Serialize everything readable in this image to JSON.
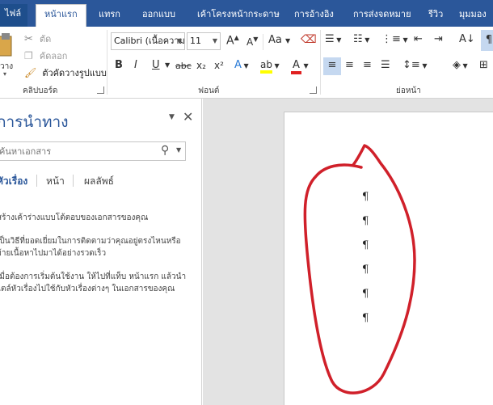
{
  "tabs": [
    {
      "label": "ไฟล์"
    },
    {
      "label": "หน้าแรก"
    },
    {
      "label": "แทรก"
    },
    {
      "label": "ออกแบบ"
    },
    {
      "label": "เค้าโครงหน้ากระดาษ"
    },
    {
      "label": "การอ้างอิง"
    },
    {
      "label": "การส่งจดหมาย"
    },
    {
      "label": "รีวิว"
    },
    {
      "label": "มุมมอง"
    }
  ],
  "clipboard": {
    "paste_label": "วาง",
    "cut_label": "ตัด",
    "copy_label": "คัดลอก",
    "format_painter_label": "ตัวคัดวางรูปแบบ",
    "group_label": "คลิปบอร์ด"
  },
  "font": {
    "font_name": "Calibri (เนื้อความ",
    "font_size": "11",
    "group_label": "ฟอนต์",
    "bold": "B",
    "italic": "I",
    "underline": "U",
    "strike": "abc",
    "subscript": "x₂",
    "superscript": "x²",
    "grow": "A",
    "shrink": "A",
    "change_case": "Aa",
    "highlight": "ab",
    "font_color": "A",
    "text_effect": "A",
    "highlight_color": "#ffff00",
    "font_color_value": "#e02020"
  },
  "paragraph": {
    "group_label": "ย่อหน้า",
    "pilcrow_btn": "¶"
  },
  "navigation": {
    "title": "การนำทาง",
    "search_placeholder": "ค้นหาเอกสาร",
    "tabs": [
      "หัวเรื่อง",
      "หน้า",
      "ผลลัพธ์"
    ],
    "info": [
      "สร้างเค้าร่างแบบโต้ตอบของเอกสารของคุณ",
      "เป็นวิธีที่ยอดเยี่ยมในการติดตามว่าคุณอยู่ตรงไหนหรือ",
      "ย้ายเนื้อหาไปมาได้อย่างรวดเร็ว",
      "เมื่อต้องการเริ่มต้นใช้งาน ให้ไปที่แท็บ หน้าแรก แล้วนำ",
      "ไตล์หัวเรื่องไปใช้กับหัวเรื่องต่างๆ ในเอกสารของคุณ"
    ]
  },
  "document": {
    "pilcrows": [
      "¶",
      "¶",
      "¶",
      "¶",
      "¶",
      "¶"
    ],
    "annotation_color": "#d0202a"
  }
}
